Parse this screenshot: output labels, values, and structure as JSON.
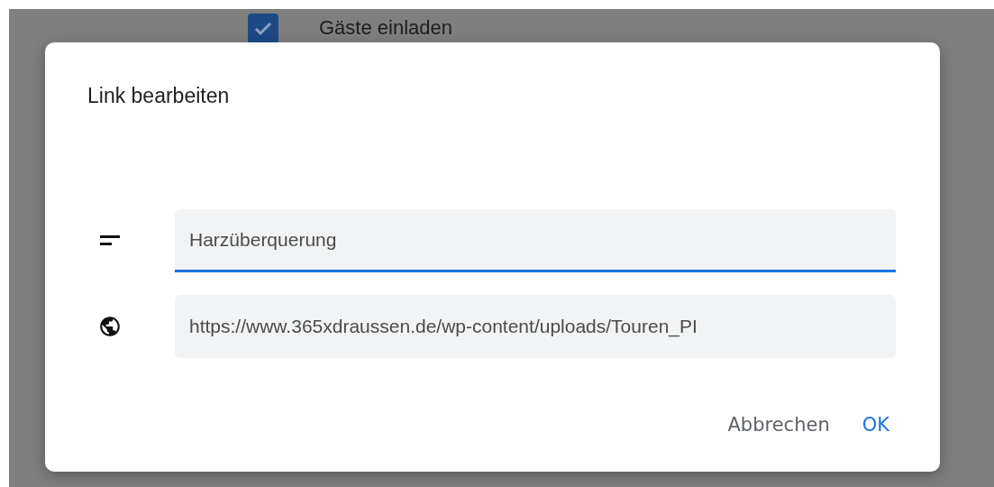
{
  "background": {
    "checkbox": {
      "label": "Gäste einladen",
      "checked": true
    }
  },
  "dialog": {
    "title": "Link bearbeiten",
    "fields": [
      {
        "kind": "text",
        "value": "Harzüberquerung",
        "focused": true
      },
      {
        "kind": "link",
        "value": "https://www.365xdraussen.de/wp-content/uploads/Touren_PI",
        "focused": false
      }
    ],
    "buttons": [
      {
        "label": "Abbrechen",
        "primary": false
      },
      {
        "label": "OK",
        "primary": true
      }
    ]
  }
}
